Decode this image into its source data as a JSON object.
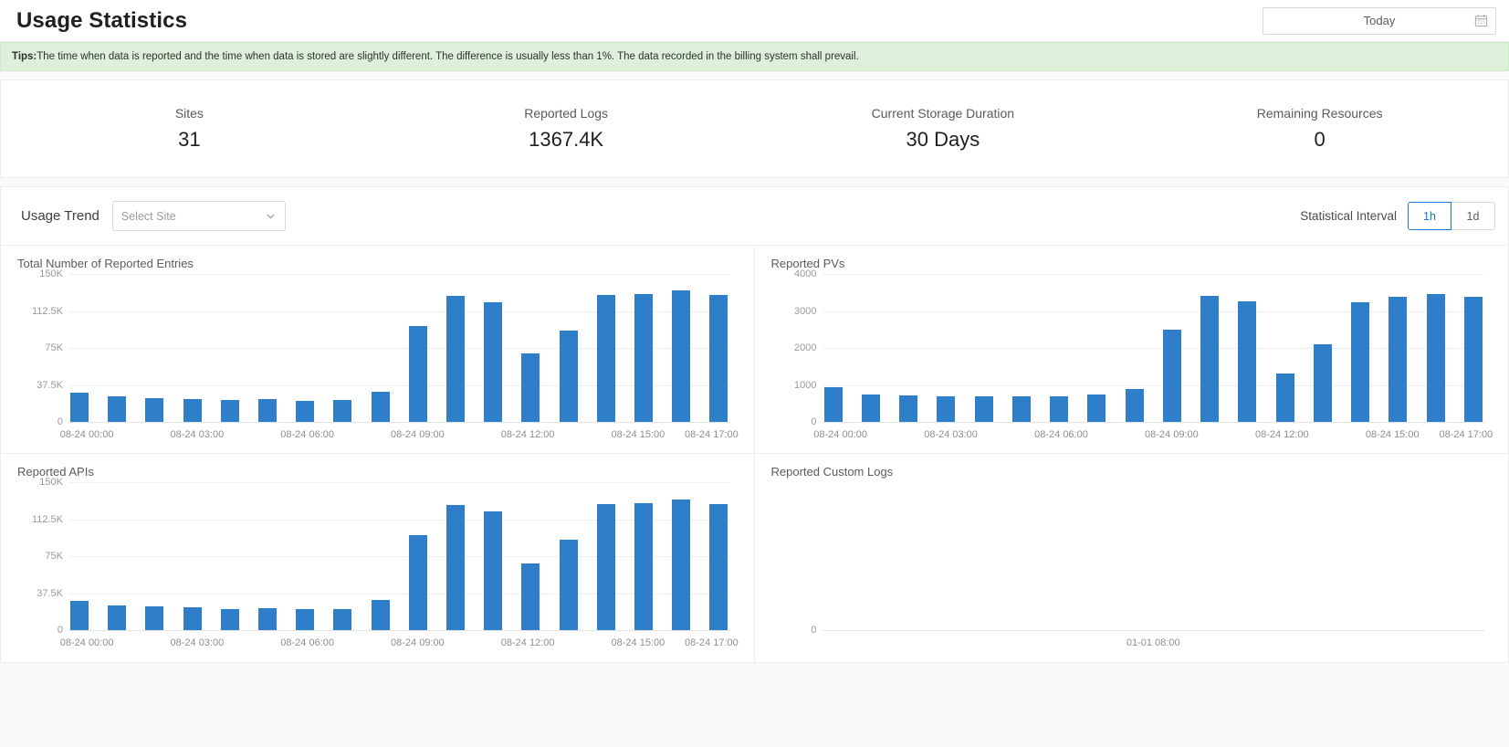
{
  "header": {
    "title": "Usage Statistics",
    "datepicker": {
      "value": "Today",
      "icon": "calendar-icon"
    }
  },
  "tips": {
    "prefix": "Tips:",
    "text": "The time when data is reported and the time when data is stored are slightly different. The difference is usually less than 1%. The data recorded in the billing system shall prevail."
  },
  "stats": [
    {
      "label": "Sites",
      "value": "31"
    },
    {
      "label": "Reported Logs",
      "value": "1367.4K"
    },
    {
      "label": "Current Storage Duration",
      "value": "30 Days"
    },
    {
      "label": "Remaining Resources",
      "value": "0"
    }
  ],
  "trend": {
    "title": "Usage Trend",
    "site_select": {
      "placeholder": "Select Site",
      "value": "",
      "icon": "chevron-down-icon"
    },
    "interval_label": "Statistical Interval",
    "intervals": [
      {
        "label": "1h",
        "active": true
      },
      {
        "label": "1d",
        "active": false
      }
    ]
  },
  "colors": {
    "bar": "#2e7ec9",
    "accent": "#1677d2",
    "tips_bg": "#ddf0da"
  },
  "chart_data": [
    {
      "type": "bar",
      "title": "Total Number of Reported Entries",
      "xlabel": "",
      "ylabel": "",
      "ylim": [
        0,
        150000
      ],
      "yticks": [
        0,
        37500,
        75000,
        112500,
        150000
      ],
      "ytick_labels": [
        "0",
        "37.5K",
        "75K",
        "112.5K",
        "150K"
      ],
      "grid": true,
      "categories": [
        "08-24 00:00",
        "08-24 01:00",
        "08-24 02:00",
        "08-24 03:00",
        "08-24 04:00",
        "08-24 05:00",
        "08-24 06:00",
        "08-24 07:00",
        "08-24 08:00",
        "08-24 09:00",
        "08-24 10:00",
        "08-24 11:00",
        "08-24 12:00",
        "08-24 13:00",
        "08-24 14:00",
        "08-24 15:00",
        "08-24 16:00",
        "08-24 17:00"
      ],
      "tick_labels": [
        "08-24 00:00",
        "08-24 03:00",
        "08-24 06:00",
        "08-24 09:00",
        "08-24 12:00",
        "08-24 15:00",
        "08-24 17:00"
      ],
      "tick_indices": [
        0,
        3,
        6,
        9,
        12,
        15,
        17
      ],
      "values": [
        30000,
        25500,
        24500,
        23500,
        22000,
        23000,
        21500,
        22000,
        31000,
        97000,
        128000,
        121000,
        69000,
        93000,
        128500,
        130000,
        133000,
        128500
      ]
    },
    {
      "type": "bar",
      "title": "Reported PVs",
      "xlabel": "",
      "ylabel": "",
      "ylim": [
        0,
        4000
      ],
      "yticks": [
        0,
        1000,
        2000,
        3000,
        4000
      ],
      "ytick_labels": [
        "0",
        "1000",
        "2000",
        "3000",
        "4000"
      ],
      "grid": true,
      "categories": [
        "08-24 00:00",
        "08-24 01:00",
        "08-24 02:00",
        "08-24 03:00",
        "08-24 04:00",
        "08-24 05:00",
        "08-24 06:00",
        "08-24 07:00",
        "08-24 08:00",
        "08-24 09:00",
        "08-24 10:00",
        "08-24 11:00",
        "08-24 12:00",
        "08-24 13:00",
        "08-24 14:00",
        "08-24 15:00",
        "08-24 16:00",
        "08-24 17:00"
      ],
      "tick_labels": [
        "08-24 00:00",
        "08-24 03:00",
        "08-24 06:00",
        "08-24 09:00",
        "08-24 12:00",
        "08-24 15:00",
        "08-24 17:00"
      ],
      "tick_indices": [
        0,
        3,
        6,
        9,
        12,
        15,
        17
      ],
      "values": [
        950,
        750,
        720,
        680,
        690,
        700,
        700,
        740,
        900,
        2500,
        3420,
        3250,
        1300,
        2100,
        3240,
        3380,
        3450,
        3380
      ]
    },
    {
      "type": "bar",
      "title": "Reported APIs",
      "xlabel": "",
      "ylabel": "",
      "ylim": [
        0,
        150000
      ],
      "yticks": [
        0,
        37500,
        75000,
        112500,
        150000
      ],
      "ytick_labels": [
        "0",
        "37.5K",
        "75K",
        "112.5K",
        "150K"
      ],
      "grid": true,
      "categories": [
        "08-24 00:00",
        "08-24 01:00",
        "08-24 02:00",
        "08-24 03:00",
        "08-24 04:00",
        "08-24 05:00",
        "08-24 06:00",
        "08-24 07:00",
        "08-24 08:00",
        "08-24 09:00",
        "08-24 10:00",
        "08-24 11:00",
        "08-24 12:00",
        "08-24 13:00",
        "08-24 14:00",
        "08-24 15:00",
        "08-24 16:00",
        "08-24 17:00"
      ],
      "tick_labels": [
        "08-24 00:00",
        "08-24 03:00",
        "08-24 06:00",
        "08-24 09:00",
        "08-24 12:00",
        "08-24 15:00",
        "08-24 17:00"
      ],
      "tick_indices": [
        0,
        3,
        6,
        9,
        12,
        15,
        17
      ],
      "values": [
        29500,
        25000,
        24000,
        23000,
        21500,
        22500,
        21000,
        21500,
        30500,
        96000,
        127000,
        120000,
        68000,
        92000,
        127500,
        129000,
        132000,
        127500
      ]
    },
    {
      "type": "bar",
      "title": "Reported Custom Logs",
      "xlabel": "",
      "ylabel": "",
      "ylim": [
        0,
        0
      ],
      "yticks": [
        0
      ],
      "ytick_labels": [
        "0"
      ],
      "grid": true,
      "categories": [
        "01-01 08:00"
      ],
      "tick_labels": [
        "01-01 08:00"
      ],
      "tick_indices": [
        0
      ],
      "values": []
    }
  ]
}
